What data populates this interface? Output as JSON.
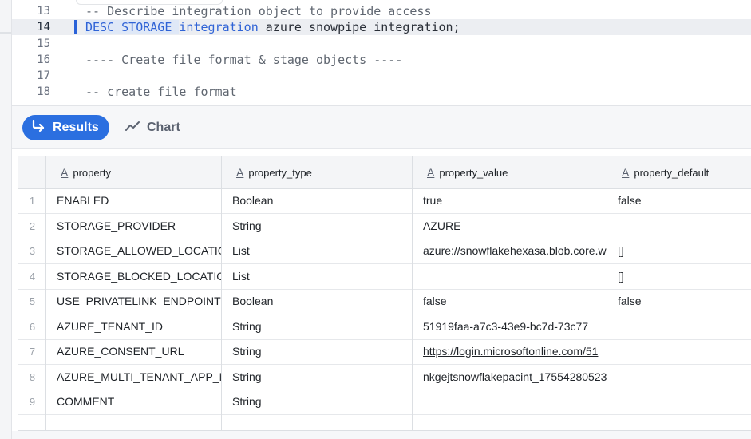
{
  "editor": {
    "lines": [
      {
        "num": "13",
        "parts": [
          {
            "t": "-- Describe integration object to provide access",
            "c": "cmt"
          }
        ]
      },
      {
        "num": "14",
        "active": true,
        "parts": [
          {
            "t": "DESC STORAGE ",
            "c": "kw hl"
          },
          {
            "t": "integration",
            "c": "kw"
          },
          {
            "t": " azure_snowpipe_integration;",
            "c": "ident"
          }
        ]
      },
      {
        "num": "15",
        "parts": []
      },
      {
        "num": "16",
        "parts": [
          {
            "t": "---- Create file format & stage objects ----",
            "c": "cmt"
          }
        ]
      },
      {
        "num": "17",
        "parts": []
      },
      {
        "num": "18",
        "parts": [
          {
            "t": "-- create file format",
            "c": "cmt"
          }
        ]
      }
    ]
  },
  "toolbar": {
    "results_label": "Results",
    "chart_label": "Chart",
    "results_icon": "arrow-turn-right-icon",
    "chart_icon": "line-chart-icon",
    "accent_color": "#2b6fe0"
  },
  "table": {
    "columns": [
      {
        "label": "property",
        "type_icon": "A"
      },
      {
        "label": "property_type",
        "type_icon": "A"
      },
      {
        "label": "property_value",
        "type_icon": "A"
      },
      {
        "label": "property_default",
        "type_icon": "A"
      }
    ],
    "rows": [
      {
        "n": "1",
        "property": "ENABLED",
        "property_type": "Boolean",
        "property_value": "true",
        "property_default": "false"
      },
      {
        "n": "2",
        "property": "STORAGE_PROVIDER",
        "property_type": "String",
        "property_value": "AZURE",
        "property_default": ""
      },
      {
        "n": "3",
        "property": "STORAGE_ALLOWED_LOCATIONS",
        "property_type": "List",
        "property_value": "azure://snowflakehexasa.blob.core.windows.net",
        "property_default": "[]"
      },
      {
        "n": "4",
        "property": "STORAGE_BLOCKED_LOCATIONS",
        "property_type": "List",
        "property_value": "",
        "property_default": "[]"
      },
      {
        "n": "5",
        "property": "USE_PRIVATELINK_ENDPOINT",
        "property_type": "Boolean",
        "property_value": "false",
        "property_default": "false"
      },
      {
        "n": "6",
        "property": "AZURE_TENANT_ID",
        "property_type": "String",
        "property_value": "51919faa-a7c3-43e9-bc7d-73c77",
        "property_default": ""
      },
      {
        "n": "7",
        "property": "AZURE_CONSENT_URL",
        "property_type": "String",
        "property_value": "https://login.microsoftonline.com/51",
        "property_default": "",
        "value_is_link": true
      },
      {
        "n": "8",
        "property": "AZURE_MULTI_TENANT_APP_NAME",
        "property_type": "String",
        "property_value": "nkgejtsnowflakepacint_17554280523",
        "property_default": ""
      },
      {
        "n": "9",
        "property": "COMMENT",
        "property_type": "String",
        "property_value": "",
        "property_default": ""
      }
    ]
  }
}
